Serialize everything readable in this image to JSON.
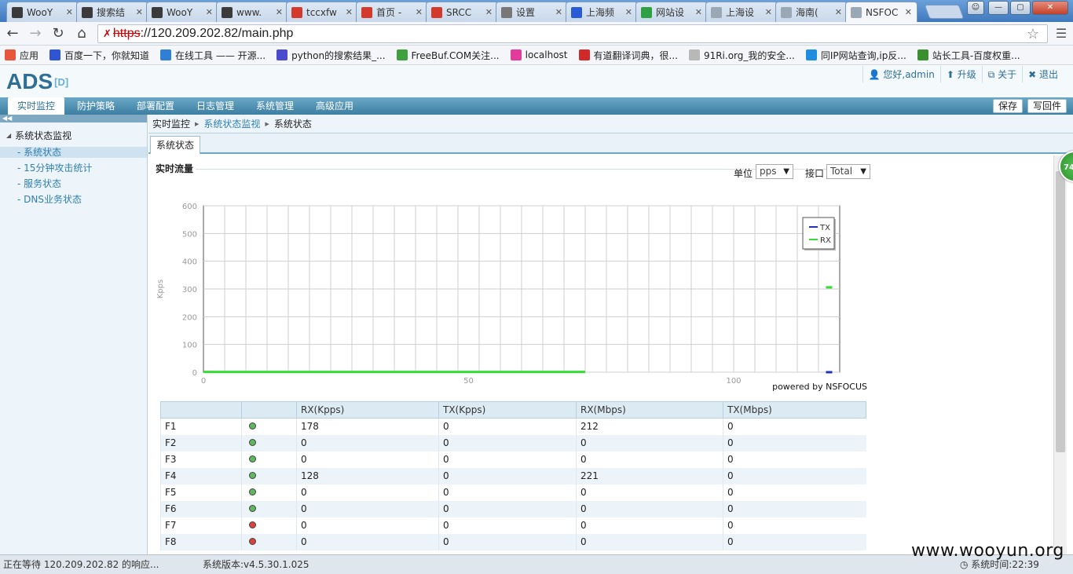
{
  "browser": {
    "tabs": [
      {
        "title": "WooY",
        "color": "#3b3b3b"
      },
      {
        "title": "搜索结",
        "color": "#3b3b3b"
      },
      {
        "title": "WooY",
        "color": "#3b3b3b"
      },
      {
        "title": "www.",
        "color": "#3b3b3b"
      },
      {
        "title": "tccxfw",
        "color": "#d33a2c"
      },
      {
        "title": "首页 -",
        "color": "#d33a2c"
      },
      {
        "title": "SRCC",
        "color": "#d33a2c"
      },
      {
        "title": "设置",
        "color": "#777777"
      },
      {
        "title": "上海频",
        "color": "#2a5bd7"
      },
      {
        "title": "网站设",
        "color": "#2ea043"
      },
      {
        "title": "上海设",
        "color": "#9aa7b5"
      },
      {
        "title": "海南(",
        "color": "#9aa7b5"
      },
      {
        "title": "NSFOC",
        "color": "#9aa7b5"
      }
    ],
    "url_protocol": "https",
    "url_rest": "://120.209.202.82/main.php",
    "bookmarks": [
      {
        "label": "应用",
        "color": "#e8553b"
      },
      {
        "label": "百度一下，你就知道",
        "color": "#2f55d4"
      },
      {
        "label": "在线工具 —— 开源...",
        "color": "#2f7fd4"
      },
      {
        "label": "python的搜索结果_...",
        "color": "#4a4acf"
      },
      {
        "label": "FreeBuf.COM关注...",
        "color": "#3da13d"
      },
      {
        "label": "localhost",
        "color": "#e33b9c"
      },
      {
        "label": "有道翻译词典，很...",
        "color": "#d12a2a"
      },
      {
        "label": "91Ri.org_我的安全...",
        "color": "#b8b8b8"
      },
      {
        "label": "同IP网站查询,ip反...",
        "color": "#1e8fe0"
      },
      {
        "label": "站长工具-百度权重...",
        "color": "#3a8f2e"
      }
    ]
  },
  "app": {
    "logo": "ADS",
    "logo_sub": "[D]",
    "user_links": [
      "您好,admin",
      "升级",
      "关于",
      "退出"
    ],
    "nav": [
      "实时监控",
      "防护策略",
      "部署配置",
      "日志管理",
      "系统管理",
      "高级应用"
    ],
    "actions": [
      "保存",
      "写回件"
    ],
    "sidebar": {
      "group": "系统状态监视",
      "items": [
        "系统状态",
        "15分钟攻击统计",
        "服务状态",
        "DNS业务状态"
      ]
    },
    "breadcrumb": [
      "实时监控",
      "系统状态监视",
      "系统状态"
    ],
    "subtab": "系统状态",
    "section_title": "实时流量",
    "unit_label": "单位",
    "unit_value": "pps",
    "iface_label": "接口",
    "iface_value": "Total",
    "powered_by": "powered by NSFOCUS",
    "badge": "74"
  },
  "chart_data": {
    "type": "line",
    "ylabel": "Kpps",
    "xlabel": "",
    "xlim": [
      0,
      120
    ],
    "ylim": [
      0,
      600
    ],
    "x_ticks": [
      0,
      50,
      100
    ],
    "y_ticks": [
      0,
      100,
      200,
      300,
      400,
      500,
      600
    ],
    "grid": true,
    "legend_position": "top-right",
    "series": [
      {
        "name": "TX",
        "color": "#2233bb",
        "points": [
          [
            118,
            0
          ]
        ]
      },
      {
        "name": "RX",
        "color": "#33dd33",
        "points": [
          [
            0,
            1
          ],
          [
            72,
            1
          ],
          [
            118,
            306
          ]
        ]
      }
    ]
  },
  "table": {
    "headers": [
      "",
      "",
      "RX(Kpps)",
      "TX(Kpps)",
      "RX(Mbps)",
      "TX(Mbps)"
    ],
    "rows": [
      {
        "port": "F1",
        "status": "green",
        "rx_kpps": "178",
        "tx_kpps": "0",
        "rx_mbps": "212",
        "tx_mbps": "0"
      },
      {
        "port": "F2",
        "status": "green",
        "rx_kpps": "0",
        "tx_kpps": "0",
        "rx_mbps": "0",
        "tx_mbps": "0"
      },
      {
        "port": "F3",
        "status": "green",
        "rx_kpps": "0",
        "tx_kpps": "0",
        "rx_mbps": "0",
        "tx_mbps": "0"
      },
      {
        "port": "F4",
        "status": "green",
        "rx_kpps": "128",
        "tx_kpps": "0",
        "rx_mbps": "221",
        "tx_mbps": "0"
      },
      {
        "port": "F5",
        "status": "green",
        "rx_kpps": "0",
        "tx_kpps": "0",
        "rx_mbps": "0",
        "tx_mbps": "0"
      },
      {
        "port": "F6",
        "status": "green",
        "rx_kpps": "0",
        "tx_kpps": "0",
        "rx_mbps": "0",
        "tx_mbps": "0"
      },
      {
        "port": "F7",
        "status": "red",
        "rx_kpps": "0",
        "tx_kpps": "0",
        "rx_mbps": "0",
        "tx_mbps": "0"
      },
      {
        "port": "F8",
        "status": "red",
        "rx_kpps": "0",
        "tx_kpps": "0",
        "rx_mbps": "0",
        "tx_mbps": "0"
      }
    ]
  },
  "status_colors": {
    "green": "#5cb85c",
    "red": "#d9413b"
  },
  "statusbar": {
    "left": "正在等待 120.209.202.82 的响应...",
    "version": "系统版本:v4.5.30.1.025",
    "time": "系统时间:22:39"
  },
  "watermark": "www.wooyun.org"
}
